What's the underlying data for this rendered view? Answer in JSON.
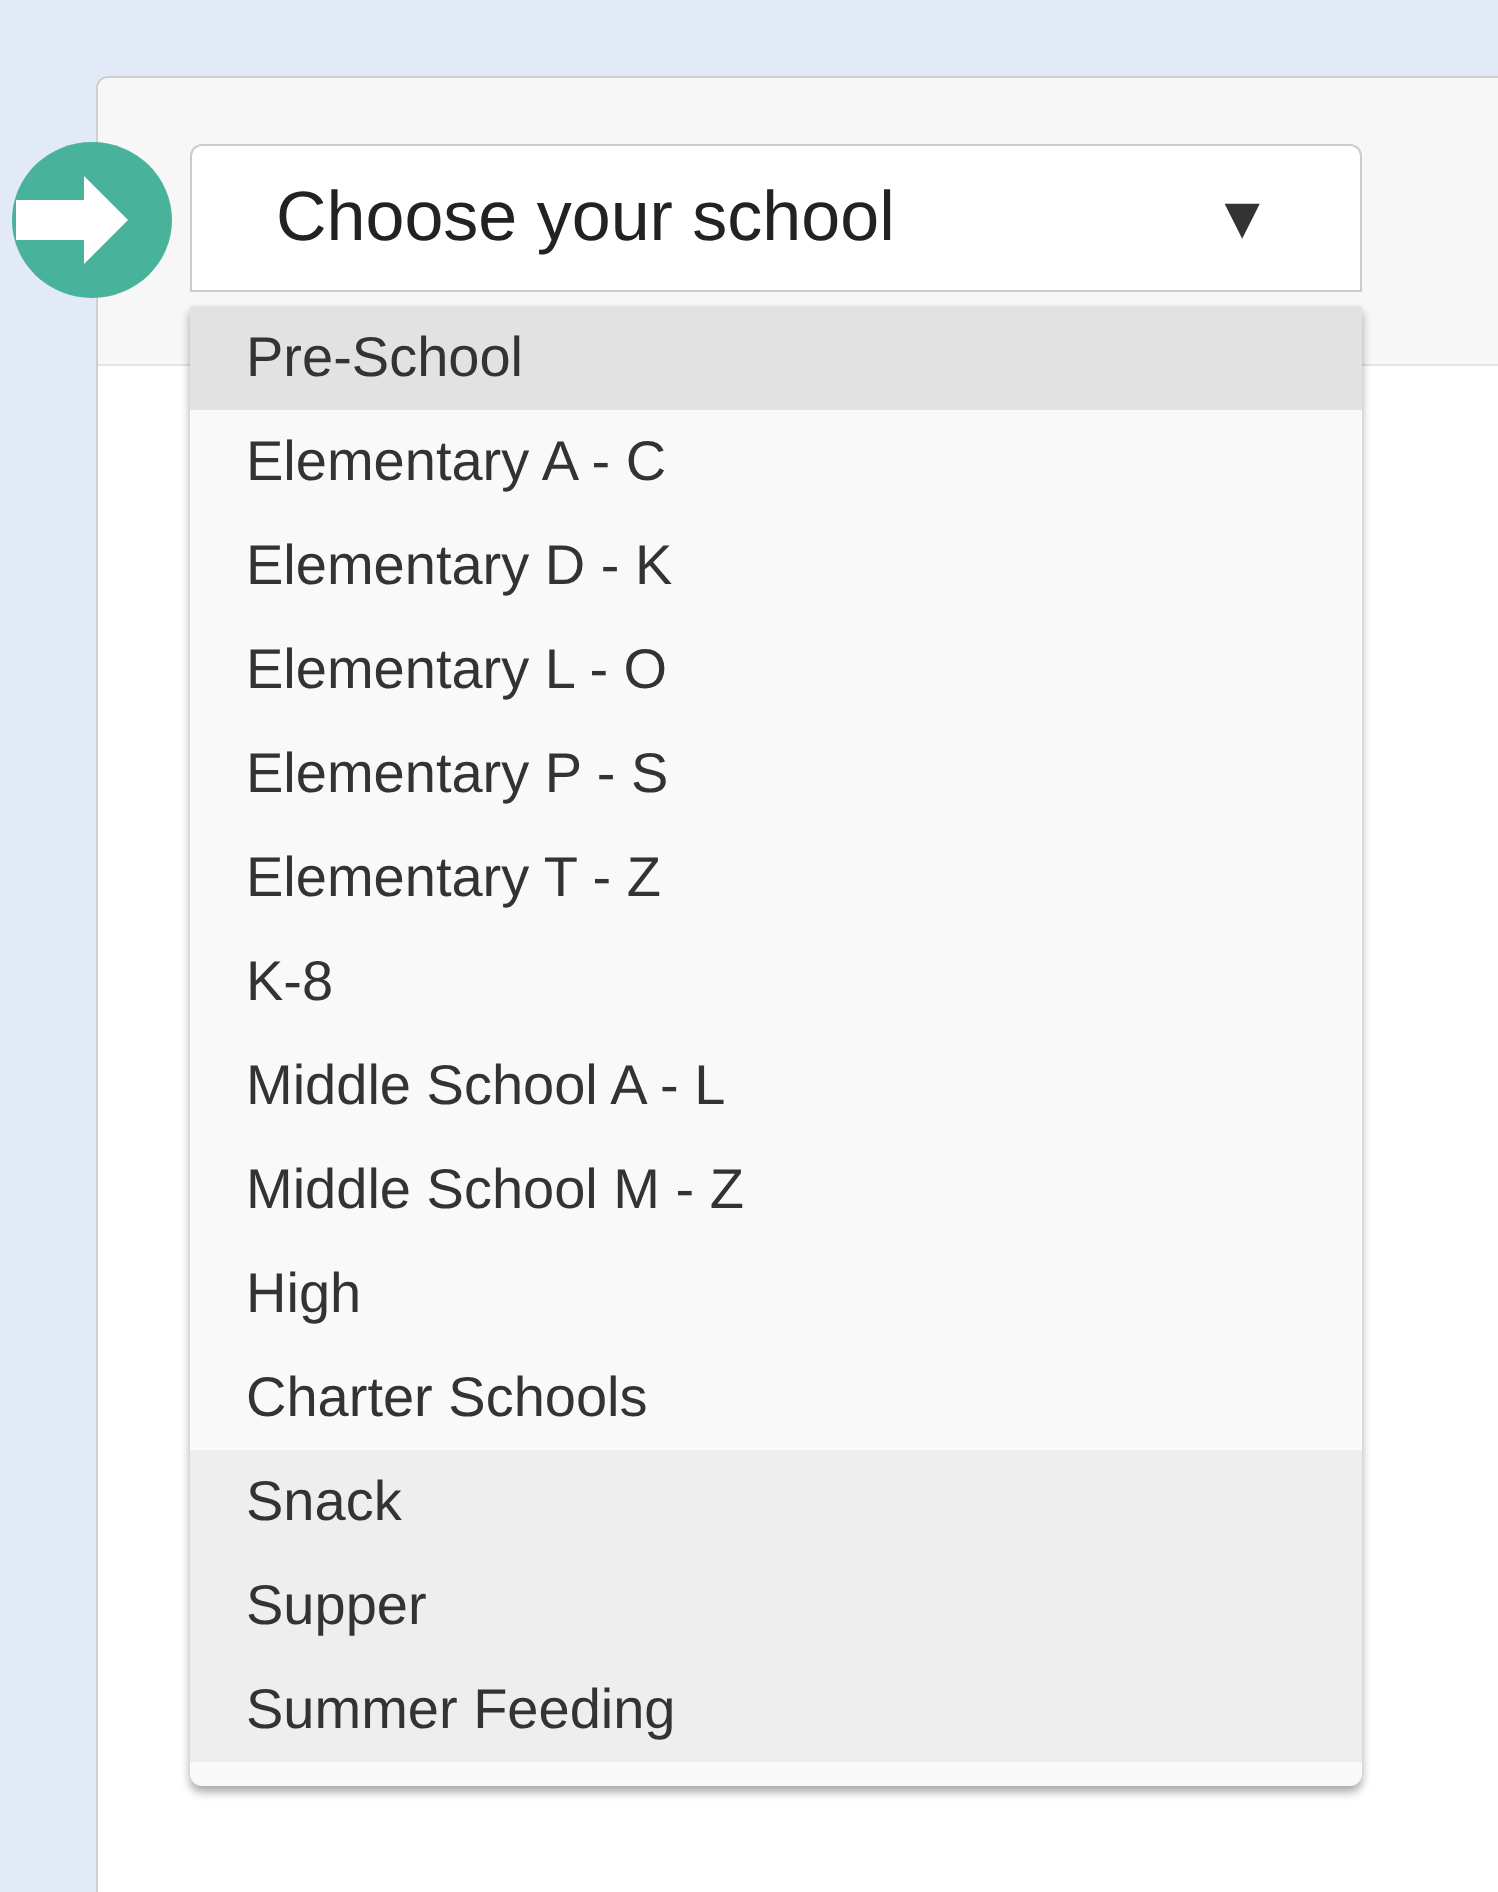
{
  "dropdown": {
    "label": "Choose your school",
    "caret": "▼",
    "expanded": true
  },
  "options": [
    {
      "label": "Pre-School",
      "kind": "school",
      "selected": true
    },
    {
      "label": "Elementary A - C",
      "kind": "school",
      "selected": false
    },
    {
      "label": "Elementary D - K",
      "kind": "school",
      "selected": false
    },
    {
      "label": "Elementary L - O",
      "kind": "school",
      "selected": false
    },
    {
      "label": "Elementary P - S",
      "kind": "school",
      "selected": false
    },
    {
      "label": "Elementary T - Z",
      "kind": "school",
      "selected": false
    },
    {
      "label": "K-8",
      "kind": "school",
      "selected": false
    },
    {
      "label": "Middle School A - L",
      "kind": "school",
      "selected": false
    },
    {
      "label": "Middle School M - Z",
      "kind": "school",
      "selected": false
    },
    {
      "label": "High",
      "kind": "school",
      "selected": false
    },
    {
      "label": "Charter Schools",
      "kind": "school",
      "selected": false
    },
    {
      "label": "Snack",
      "kind": "meal",
      "selected": false
    },
    {
      "label": "Supper",
      "kind": "meal",
      "selected": false
    },
    {
      "label": "Summer Feeding",
      "kind": "meal",
      "selected": false
    }
  ]
}
